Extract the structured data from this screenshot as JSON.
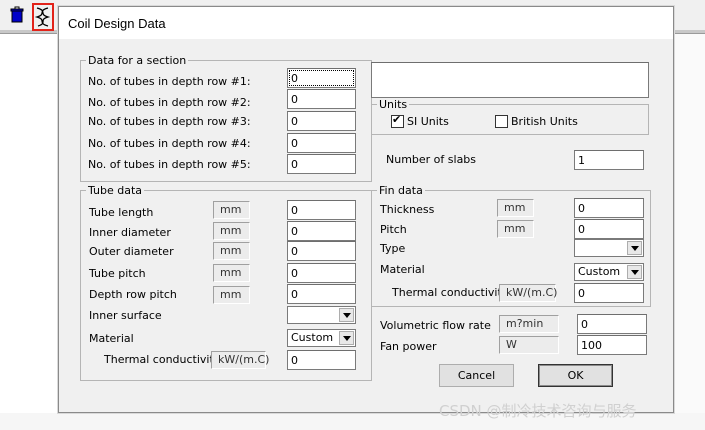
{
  "window": {
    "title": "Coil Design Data"
  },
  "toolbar_icons": [
    "trash-icon",
    "coil-icon"
  ],
  "section": {
    "legend": "Data for a section",
    "rows": [
      {
        "label": "No. of tubes in depth row #1:",
        "value": "0"
      },
      {
        "label": "No. of tubes in depth row #2:",
        "value": "0"
      },
      {
        "label": "No. of tubes in depth row #3:",
        "value": "0"
      },
      {
        "label": "No. of tubes in depth row #4:",
        "value": "0"
      },
      {
        "label": "No. of tubes in depth row #5:",
        "value": "0"
      }
    ]
  },
  "tube": {
    "legend": "Tube data",
    "rows": [
      {
        "label": "Tube length",
        "unit": "mm",
        "value": "0"
      },
      {
        "label": "Inner diameter",
        "unit": "mm",
        "value": "0"
      },
      {
        "label": "Outer diameter",
        "unit": "mm",
        "value": "0"
      },
      {
        "label": "Tube pitch",
        "unit": "mm",
        "value": "0"
      },
      {
        "label": "Depth row pitch",
        "unit": "mm",
        "value": "0"
      }
    ],
    "inner_surface": {
      "label": "Inner surface",
      "value": ""
    },
    "material": {
      "label": "Material",
      "value": "Custom"
    },
    "conductivity": {
      "label": "Thermal conductivity",
      "unit": "kW/(m.C)",
      "value": "0"
    }
  },
  "notes": {
    "value": ""
  },
  "units": {
    "legend": "Units",
    "si": {
      "label": "SI Units",
      "checked": true
    },
    "british": {
      "label": "British Units",
      "checked": false
    }
  },
  "slabs": {
    "label": "Number of slabs",
    "value": "1"
  },
  "fin": {
    "legend": "Fin data",
    "rows": [
      {
        "label": "Thickness",
        "unit": "mm",
        "value": "0"
      },
      {
        "label": "Pitch",
        "unit": "mm",
        "value": "0"
      }
    ],
    "type": {
      "label": "Type",
      "value": ""
    },
    "material": {
      "label": "Material",
      "value": "Custom"
    },
    "conductivity": {
      "label": "Thermal conductivity",
      "unit": "kW/(m.C)",
      "value": "0"
    }
  },
  "flow": {
    "volumetric": {
      "label": "Volumetric flow rate",
      "unit": "m?min",
      "value": "0"
    },
    "fan": {
      "label": "Fan power",
      "unit": "W",
      "value": "100"
    }
  },
  "buttons": {
    "cancel": "Cancel",
    "ok": "OK"
  },
  "watermark": "CSDN @制冷技术咨询与服务"
}
